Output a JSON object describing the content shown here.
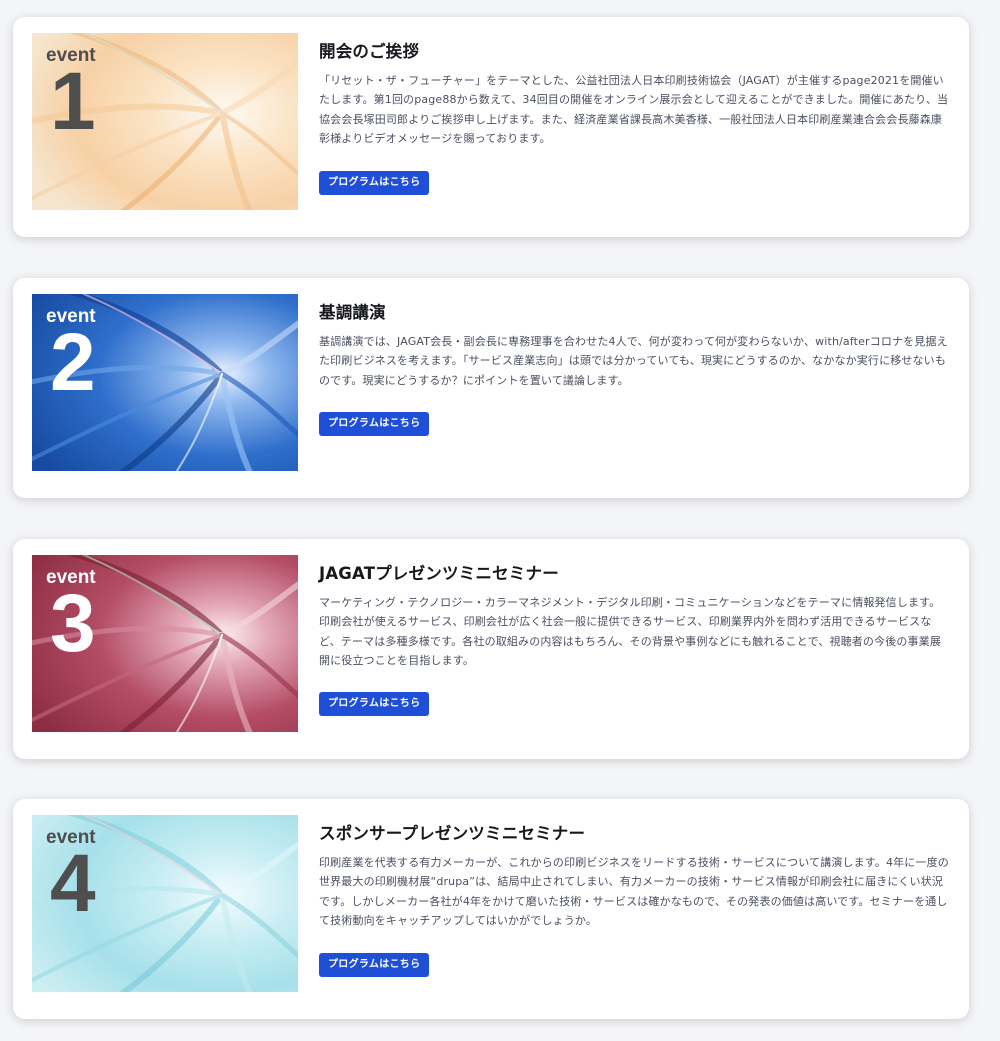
{
  "events": [
    {
      "badge_word": "event",
      "badge_number": "1",
      "title": "開会のご挨拶",
      "description": "「リセット・ザ・フューチャー」をテーマとした、公益社団法人日本印刷技術協会（JAGAT）が主催するpage2021を開催いたします。第1回のpage88から数えて、34回目の開催をオンライン展示会として迎えることができました。開催にあたり、当協会会長塚田司郎よりご挨拶申し上げます。また、経済産業省課長高木美香様、一般社団法人日本印刷産業連合会会長藤森康彰様よりビデオメッセージを賜っております。",
      "button_label": "プログラムはこちら",
      "theme": "peach"
    },
    {
      "badge_word": "event",
      "badge_number": "2",
      "title": "基調講演",
      "description": "基調講演では、JAGAT会長・副会長に専務理事を合わせた4人で、何が変わって何が変わらないか、with/afterコロナを見据えた印刷ビジネスを考えます。「サービス産業志向」は頭では分かっていても、現実にどうするのか、なかなか実行に移せないものです。現実にどうするか？にポイントを置いて議論します。",
      "button_label": "プログラムはこちら",
      "theme": "blue"
    },
    {
      "badge_word": "event",
      "badge_number": "3",
      "title": "JAGATプレゼンツミニセミナー",
      "description": "マーケティング・テクノロジー・カラーマネジメント・デジタル印刷・コミュニケーションなどをテーマに情報発信します。印刷会社が使えるサービス、印刷会社が広く社会一般に提供できるサービス、印刷業界内外を問わず活用できるサービスなど、テーマは多種多様です。各社の取組みの内容はもちろん、その背景や事例などにも触れることで、視聴者の今後の事業展開に役立つことを目指します。",
      "button_label": "プログラムはこちら",
      "theme": "crimson"
    },
    {
      "badge_word": "event",
      "badge_number": "4",
      "title": "スポンサープレゼンツミニセミナー",
      "description": "印刷産業を代表する有力メーカーが、これからの印刷ビジネスをリードする技術・サービスについて講演します。4年に一度の世界最大の印刷機材展“drupa”は、結局中止されてしまい、有力メーカーの技術・サービス情報が印刷会社に届きにくい状況です。しかしメーカー各社が4年をかけて磨いた技術・サービスは確かなもので、その発表の価値は高いです。セミナーを通して技術動向をキャッチアップしてはいかがでしょうか。",
      "button_label": "プログラムはこちら",
      "theme": "aqua"
    }
  ],
  "colors": {
    "button_bg": "#1e4fd6",
    "title_text": "#16181d",
    "body_text": "#4b5060",
    "page_bg": "#f4f5f8"
  }
}
